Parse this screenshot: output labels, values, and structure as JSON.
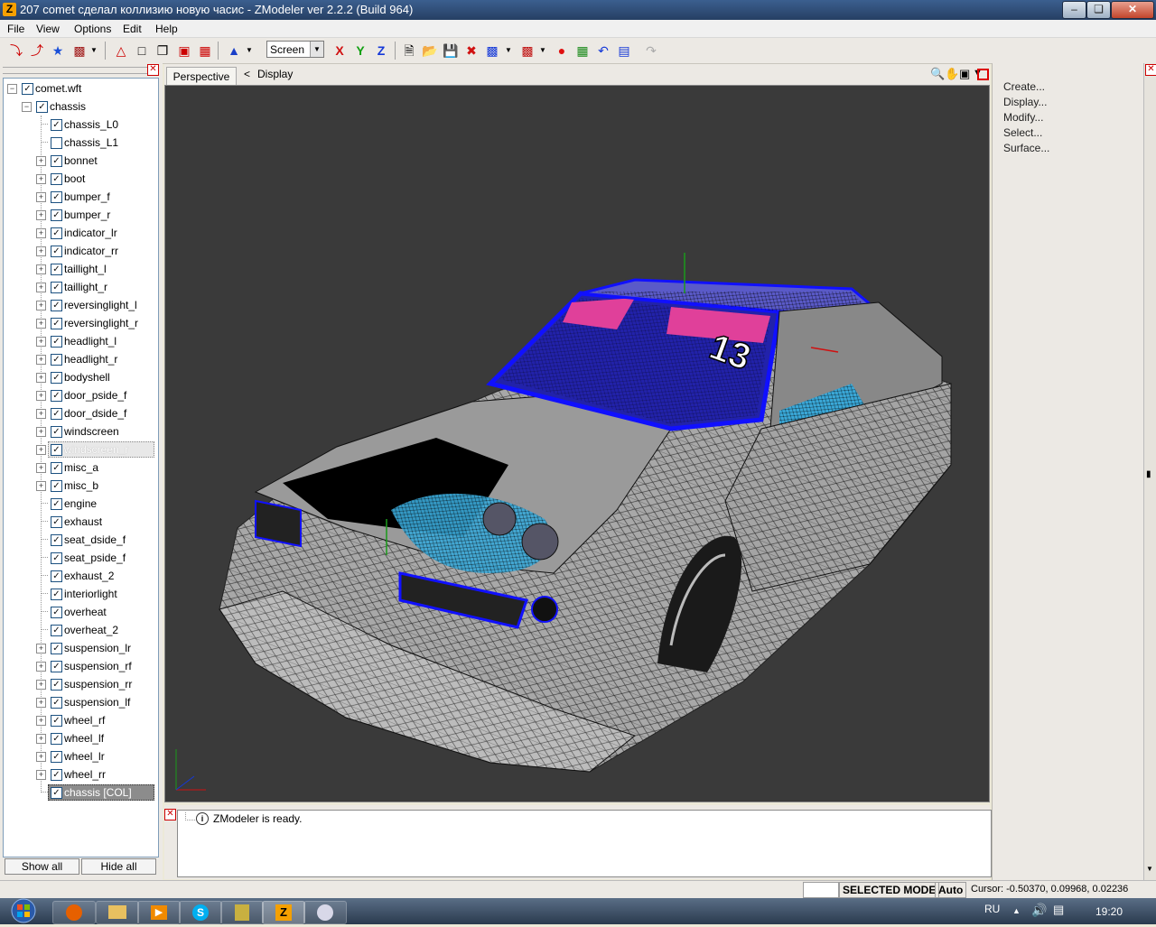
{
  "window": {
    "title": "207 comet сделал коллизию новую часис - ZModeler ver 2.2.2 (Build 964)",
    "app_icon_letter": "Z"
  },
  "menu": [
    "File",
    "View",
    "Options",
    "Edit",
    "Help"
  ],
  "toolbar": {
    "coord_space": "Screen",
    "axis_x": "X",
    "axis_y": "Y",
    "axis_z": "Z"
  },
  "tree": {
    "root": "comet.wft",
    "group": "chassis",
    "items": [
      {
        "label": "chassis_L0",
        "checked": true,
        "expander": false
      },
      {
        "label": "chassis_L1",
        "checked": false,
        "expander": false
      },
      {
        "label": "bonnet",
        "checked": true,
        "expander": true
      },
      {
        "label": "boot",
        "checked": true,
        "expander": true
      },
      {
        "label": "bumper_f",
        "checked": true,
        "expander": true
      },
      {
        "label": "bumper_r",
        "checked": true,
        "expander": true
      },
      {
        "label": "indicator_lr",
        "checked": true,
        "expander": true
      },
      {
        "label": "indicator_rr",
        "checked": true,
        "expander": true
      },
      {
        "label": "taillight_l",
        "checked": true,
        "expander": true
      },
      {
        "label": "taillight_r",
        "checked": true,
        "expander": true
      },
      {
        "label": "reversinglight_l",
        "checked": true,
        "expander": true
      },
      {
        "label": "reversinglight_r",
        "checked": true,
        "expander": true
      },
      {
        "label": "headlight_l",
        "checked": true,
        "expander": true
      },
      {
        "label": "headlight_r",
        "checked": true,
        "expander": true
      },
      {
        "label": "bodyshell",
        "checked": true,
        "expander": true
      },
      {
        "label": "door_pside_f",
        "checked": true,
        "expander": true
      },
      {
        "label": "door_dside_f",
        "checked": true,
        "expander": true
      },
      {
        "label": "windscreen",
        "checked": true,
        "expander": true
      },
      {
        "label": "windscreen_r",
        "checked": true,
        "expander": true,
        "state": "hidden"
      },
      {
        "label": "misc_a",
        "checked": true,
        "expander": true
      },
      {
        "label": "misc_b",
        "checked": true,
        "expander": true
      },
      {
        "label": "engine",
        "checked": true,
        "expander": false
      },
      {
        "label": "exhaust",
        "checked": true,
        "expander": false
      },
      {
        "label": "seat_dside_f",
        "checked": true,
        "expander": false
      },
      {
        "label": "seat_pside_f",
        "checked": true,
        "expander": false
      },
      {
        "label": "exhaust_2",
        "checked": true,
        "expander": false
      },
      {
        "label": "interiorlight",
        "checked": true,
        "expander": false
      },
      {
        "label": "overheat",
        "checked": true,
        "expander": false
      },
      {
        "label": "overheat_2",
        "checked": true,
        "expander": false
      },
      {
        "label": "suspension_lr",
        "checked": true,
        "expander": true
      },
      {
        "label": "suspension_rf",
        "checked": true,
        "expander": true
      },
      {
        "label": "suspension_rr",
        "checked": true,
        "expander": true
      },
      {
        "label": "suspension_lf",
        "checked": true,
        "expander": true
      },
      {
        "label": "wheel_rf",
        "checked": true,
        "expander": true
      },
      {
        "label": "wheel_lf",
        "checked": true,
        "expander": true
      },
      {
        "label": "wheel_lr",
        "checked": true,
        "expander": true
      },
      {
        "label": "wheel_rr",
        "checked": true,
        "expander": true
      },
      {
        "label": "chassis [COL]",
        "checked": true,
        "expander": false,
        "state": "selected"
      }
    ]
  },
  "left_buttons": {
    "show_all": "Show all",
    "hide_all": "Hide all"
  },
  "viewport": {
    "tab": "Perspective",
    "crumb_sep": "<",
    "crumb": "Display",
    "model_number": "13"
  },
  "right_panel": {
    "items": [
      "Create...",
      "Display...",
      "Modify...",
      "Select...",
      "Surface..."
    ]
  },
  "log": {
    "message": "ZModeler is ready."
  },
  "status": {
    "mode": "SELECTED MODE",
    "auto": "Auto",
    "cursor": "Cursor: -0.50370, 0.09968, 0.02236"
  },
  "taskbar": {
    "lang": "RU",
    "time": "19:20"
  },
  "colors": {
    "viewport_bg": "#3a3a3a",
    "wire_blue": "#1010ff",
    "pink": "#e0409a",
    "cyan": "#3aa8d8"
  }
}
